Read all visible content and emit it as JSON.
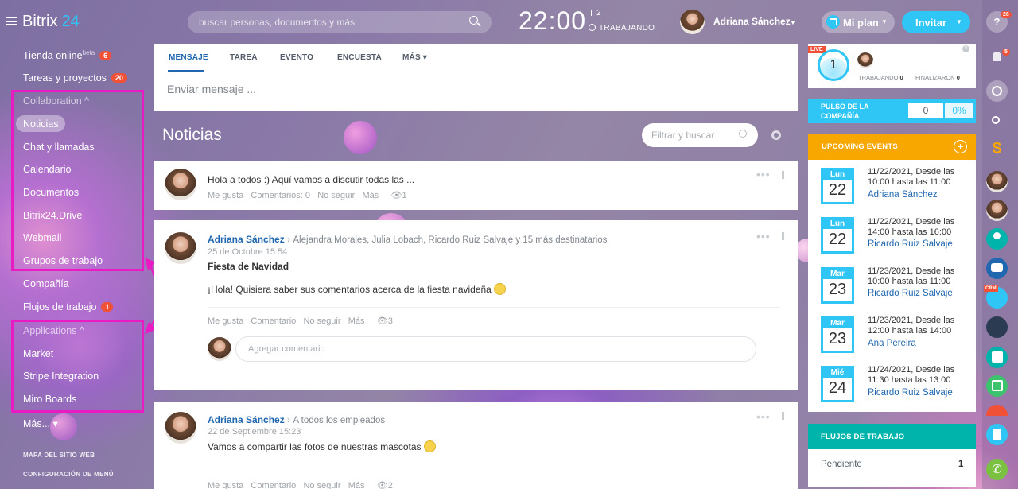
{
  "header": {
    "logo": "Bitrix",
    "logo_number": "24",
    "search_placeholder": "buscar personas, documentos y más",
    "clock": "22:00",
    "flag_count": "2",
    "work_status": "TRABAJANDO",
    "user_name": "Adriana Sánchez",
    "plan_label": "Mi plan",
    "invite_label": "Invitar"
  },
  "sidebar": {
    "items": [
      {
        "label": "Tienda online",
        "sup": "beta",
        "badge": "6"
      },
      {
        "label": "Tareas y proyectos",
        "badge": "20"
      },
      {
        "label": "Collaboration ^"
      },
      {
        "label": "Noticias"
      },
      {
        "label": "Chat y llamadas"
      },
      {
        "label": "Calendario"
      },
      {
        "label": "Documentos"
      },
      {
        "label": "Bitrix24.Drive"
      },
      {
        "label": "Webmail"
      },
      {
        "label": "Grupos de trabajo"
      },
      {
        "label": "Compañía"
      },
      {
        "label": "Flujos de trabajo",
        "badge": "1"
      },
      {
        "label": "Applications ^"
      },
      {
        "label": "Market"
      },
      {
        "label": "Stripe Integration"
      },
      {
        "label": "Miro Boards"
      },
      {
        "label": "Más... ▾"
      }
    ],
    "sitemap": "MAPA DEL SITIO WEB",
    "menu_config": "CONFIGURACIÓN DE MENÚ"
  },
  "composer": {
    "tabs": [
      "MENSAJE",
      "TAREA",
      "EVENTO",
      "ENCUESTA",
      "MÁS ▾"
    ],
    "placeholder": "Enviar mensaje ..."
  },
  "feed": {
    "title": "Noticias",
    "filter_placeholder": "Filtrar y buscar",
    "posts": [
      {
        "text": "Hola a todos :) Aquí vamos a discutir todas las ...",
        "actions": [
          "Me gusta",
          "Comentarios: 0",
          "No seguir",
          "Más"
        ],
        "views": "1"
      },
      {
        "author": "Adriana Sánchez",
        "recipients": "Alejandra Morales, Julia Lobach, Ricardo Ruiz Salvaje  y 15 más destinatarios",
        "date": "25 de Octubre 15:54",
        "title": "Fiesta de Navidad",
        "text": "¡Hola! Quisiera saber sus comentarios acerca de la fiesta navideña",
        "actions": [
          "Me gusta",
          "Comentario",
          "No seguir",
          "Más"
        ],
        "views": "3",
        "comment_placeholder": "Agregar comentario"
      },
      {
        "author": "Adriana Sánchez",
        "recipients": "A todos los empleados",
        "date": "22 de Septiembre 15:23",
        "text": "Vamos a compartir las fotos de nuestras mascotas",
        "actions": [
          "Me gusta",
          "Comentario",
          "No seguir",
          "Más"
        ],
        "views": "2"
      }
    ]
  },
  "right": {
    "live": "LIVE",
    "pulse_number": "1",
    "working_label": "TRABAJANDO",
    "working_value": "0",
    "finished_label": "FINALIZARON",
    "finished_value": "0",
    "pulse_title": "PULSO DE LA COMPAÑÍA",
    "pulse_value": "0",
    "pulse_percent": "0%",
    "events_title": "UPCOMING EVENTS",
    "events": [
      {
        "day": "Lun",
        "num": "22",
        "text": "11/22/2021, Desde las 10:00 hasta las 11:00",
        "person": "Adriana Sánchez"
      },
      {
        "day": "Lun",
        "num": "22",
        "text": "11/22/2021, Desde las 14:00 hasta las 16:00",
        "person": "Ricardo Ruiz Salvaje"
      },
      {
        "day": "Mar",
        "num": "23",
        "text": "11/23/2021, Desde las 10:00 hasta las 11:00",
        "person": "Ricardo Ruiz Salvaje"
      },
      {
        "day": "Mar",
        "num": "23",
        "text": "11/23/2021, Desde las 12:00 hasta las 14:00",
        "person": "Ana Pereira"
      },
      {
        "day": "Mié",
        "num": "24",
        "text": "11/24/2021, Desde las 11:30 hasta las 13:00",
        "person": "Ricardo Ruiz Salvaje"
      }
    ],
    "workflows_title": "FLUJOS DE TRABAJO",
    "workflows_pending": "Pendiente",
    "workflows_count": "1"
  },
  "rightbar": {
    "help_badge": "26",
    "notif_badge": "5",
    "crm_label": "CRM"
  },
  "colors": {
    "accent": "#2fc6f6",
    "highlight": "#e91cc4",
    "events_header": "#f7a700",
    "workflow_header": "#00b4ac",
    "badge": "#f05137"
  }
}
